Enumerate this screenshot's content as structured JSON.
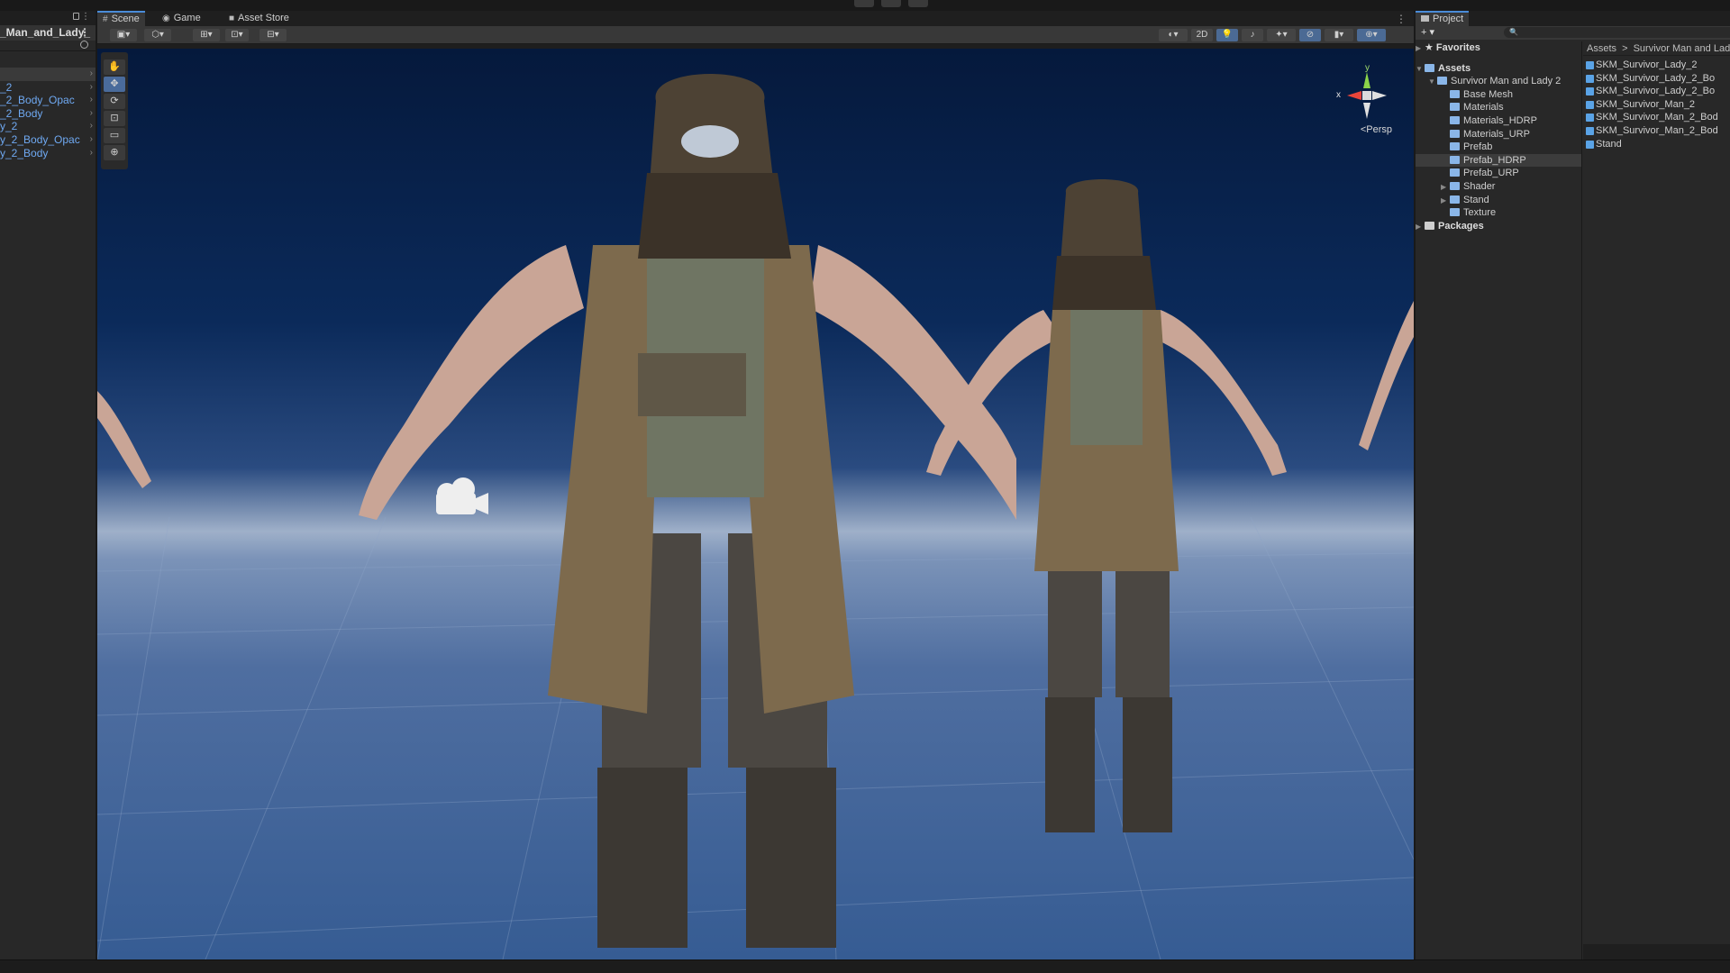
{
  "hierarchy": {
    "root_label": "_Man_and_Lady_",
    "items": [
      {
        "label": ""
      },
      {
        "label": "_2"
      },
      {
        "label": "_2_Body_Opac"
      },
      {
        "label": "_2_Body"
      },
      {
        "label": "y_2"
      },
      {
        "label": "y_2_Body_Opac"
      },
      {
        "label": "y_2_Body"
      }
    ]
  },
  "scene": {
    "tabs": [
      {
        "label": "Scene",
        "icon": "grid-icon"
      },
      {
        "label": "Game",
        "icon": "gamepad-icon"
      },
      {
        "label": "Asset Store",
        "icon": "bag-icon"
      }
    ],
    "toolbar": {
      "btn_2d": "2D"
    },
    "gizmo": {
      "x": "x",
      "y": "y",
      "projection": "<Persp"
    }
  },
  "project": {
    "tab_label": "Project",
    "add_label": "+ ▾",
    "search_placeholder": "🔍",
    "favorites": "Favorites",
    "tree": {
      "assets": "Assets",
      "package_folder": "Survivor Man and Lady 2",
      "subfolders": [
        "Base Mesh",
        "Materials",
        "Materials_HDRP",
        "Materials_URP",
        "Prefab",
        "Prefab_HDRP",
        "Prefab_URP",
        "Shader",
        "Stand",
        "Texture"
      ],
      "packages": "Packages"
    },
    "breadcrumb": {
      "root": "Assets",
      "sep": ">",
      "current": "Survivor Man and Lad"
    },
    "files": [
      "SKM_Survivor_Lady_2",
      "SKM_Survivor_Lady_2_Bo",
      "SKM_Survivor_Lady_2_Bo",
      "SKM_Survivor_Man_2",
      "SKM_Survivor_Man_2_Bod",
      "SKM_Survivor_Man_2_Bod",
      "Stand"
    ]
  },
  "colors": {
    "accent": "#4a8cd8",
    "link_blue": "#6fa9f2",
    "sky_top": "#05193c",
    "horizon": "#9fb0c9",
    "floor": "#365c93"
  }
}
